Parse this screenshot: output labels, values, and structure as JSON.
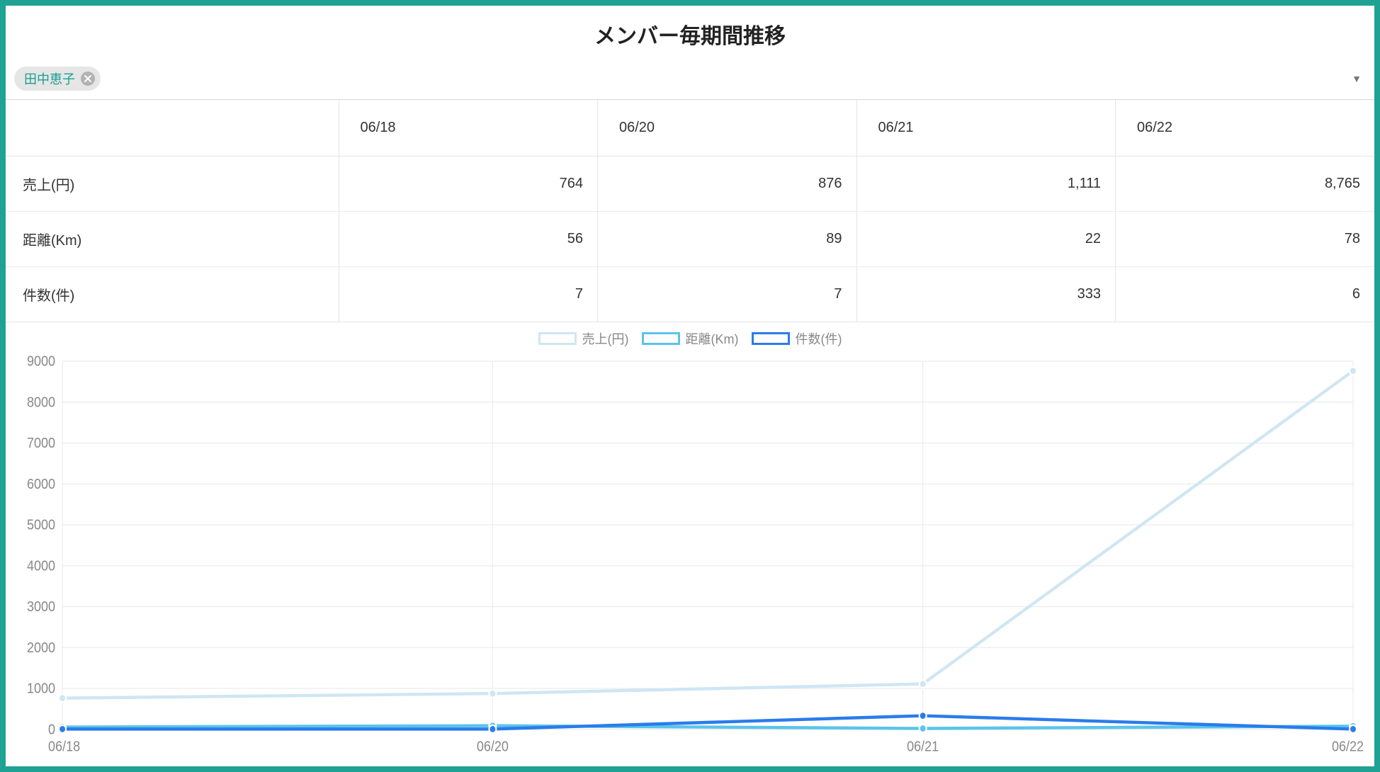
{
  "title": "メンバー毎期間推移",
  "filter": {
    "chip_label": "田中恵子"
  },
  "table": {
    "dates": [
      "06/18",
      "06/20",
      "06/21",
      "06/22"
    ],
    "rows": [
      {
        "label": "売上(円)",
        "values": [
          "764",
          "876",
          "1,111",
          "8,765"
        ]
      },
      {
        "label": "距離(Km)",
        "values": [
          "56",
          "89",
          "22",
          "78"
        ]
      },
      {
        "label": "件数(件)",
        "values": [
          "7",
          "7",
          "333",
          "6"
        ]
      }
    ]
  },
  "legend": {
    "series": [
      "売上(円)",
      "距離(Km)",
      "件数(件)"
    ],
    "colors": [
      "#cfe6f3",
      "#5ac4eb",
      "#2a7cea"
    ]
  },
  "yticks": [
    "0",
    "1000",
    "2000",
    "3000",
    "4000",
    "5000",
    "6000",
    "7000",
    "8000",
    "9000"
  ],
  "xticks": [
    "06/18",
    "06/20",
    "06/21",
    "06/22"
  ],
  "chart_data": {
    "type": "line",
    "title": "メンバー毎期間推移",
    "xlabel": "",
    "ylabel": "",
    "ylim": [
      0,
      9000
    ],
    "categories": [
      "06/18",
      "06/20",
      "06/21",
      "06/22"
    ],
    "series": [
      {
        "name": "売上(円)",
        "values": [
          764,
          876,
          1111,
          8765
        ],
        "color": "#cfe6f3"
      },
      {
        "name": "距離(Km)",
        "values": [
          56,
          89,
          22,
          78
        ],
        "color": "#5ac4eb"
      },
      {
        "name": "件数(件)",
        "values": [
          7,
          7,
          333,
          6
        ],
        "color": "#2a7cea"
      }
    ]
  }
}
